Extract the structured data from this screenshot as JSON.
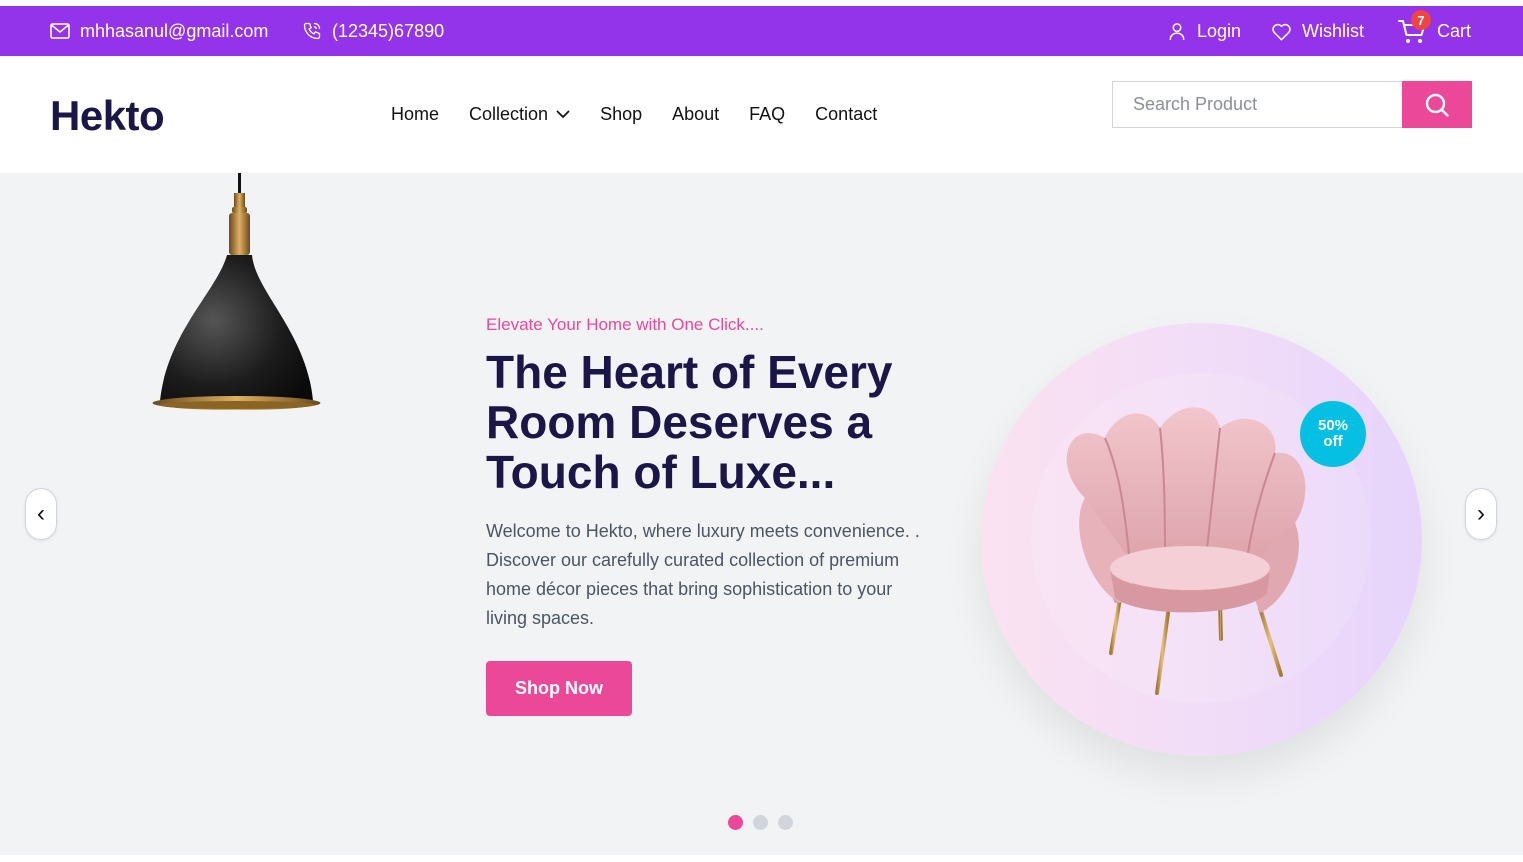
{
  "topbar": {
    "email": "mhhasanul@gmail.com",
    "phone": "(12345)67890",
    "login": "Login",
    "wishlist": "Wishlist",
    "cart": "Cart",
    "cart_count": "7",
    "icons": [
      "mail-icon",
      "phone-icon",
      "user-icon",
      "heart-icon",
      "cart-icon"
    ]
  },
  "header": {
    "logo": "Hekto",
    "nav": {
      "home": "Home",
      "collection": "Collection",
      "shop": "Shop",
      "about": "About",
      "faq": "FAQ",
      "contact": "Contact"
    },
    "search_placeholder": "Search Product"
  },
  "hero": {
    "subtitle": "Elevate Your Home with One Click....",
    "headline": "The Heart of Every Room Deserves a Touch of Luxe...",
    "description": "Welcome to Hekto, where luxury meets convenience. . Discover our carefully curated collection of premium home décor pieces that bring sophistication to your living spaces.",
    "cta": "Shop Now",
    "badge_line1": "50%",
    "badge_line2": "off",
    "prev_arrow": "‹",
    "next_arrow": "›",
    "slides_total": 3,
    "active_slide": 1
  },
  "colors": {
    "topbar": "#9333ea",
    "accent": "#ec4899",
    "navy": "#1b1648",
    "badge": "#06c0e4",
    "hero_bg": "#f2f3f5"
  }
}
